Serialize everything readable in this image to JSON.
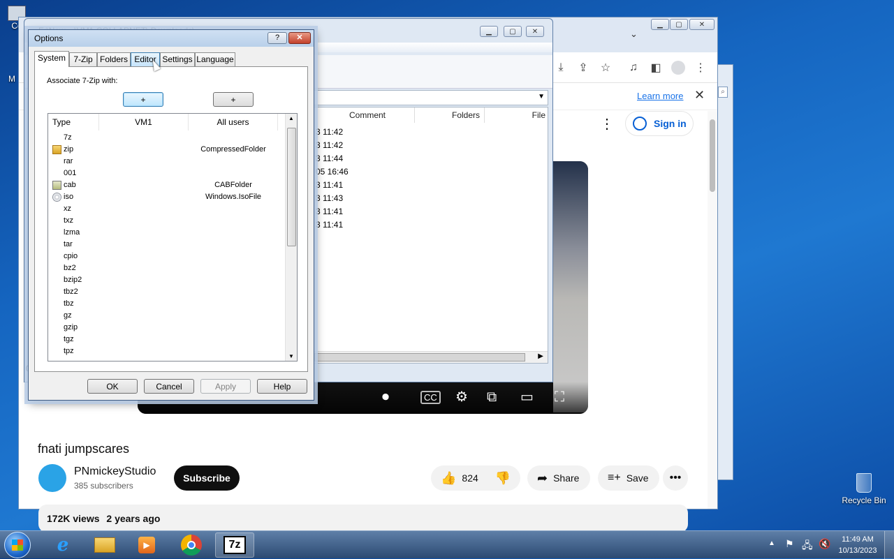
{
  "desktop": {
    "icon_top_left_label": "Co",
    "icon_left_label": "M",
    "recycle_bin_label": "Recycle Bin"
  },
  "chrome": {
    "infobar_link": "Learn more",
    "sign_in_label": "Sign in",
    "video_title": "fnati jumpscares",
    "channel_name": "PNmickeyStudio",
    "subscribers": "385 subscribers",
    "subscribe_label": "Subscribe",
    "like_count": "824",
    "share_label": "Share",
    "save_label": "Save",
    "views": "172K views",
    "age": "2 years ago"
  },
  "zip_window": {
    "title": "E:\\New... \\VM1 COLLAPNET\\ Downloads\\",
    "columns": [
      "Comment",
      "Folders",
      "File"
    ],
    "dates": [
      "3 11:42",
      "3 11:42",
      "3 11:44",
      "05 16:46",
      "3 11:41",
      "3 11:43",
      "3 11:41",
      "3 11:41"
    ],
    "status_left": "0"
  },
  "options": {
    "title": "Options",
    "help_glyph": "?",
    "close_glyph": "✕",
    "tabs": [
      "System",
      "7-Zip",
      "Folders",
      "Editor",
      "Settings",
      "Language"
    ],
    "associate_label": "Associate 7-Zip with:",
    "plus_label": "+",
    "list_headers": [
      "Type",
      "VM1",
      "All users"
    ],
    "rows": [
      {
        "ext": "7z",
        "all": ""
      },
      {
        "ext": "zip",
        "all": "CompressedFolder"
      },
      {
        "ext": "rar",
        "all": ""
      },
      {
        "ext": "001",
        "all": ""
      },
      {
        "ext": "cab",
        "all": "CABFolder"
      },
      {
        "ext": "iso",
        "all": "Windows.IsoFile"
      },
      {
        "ext": "xz",
        "all": ""
      },
      {
        "ext": "txz",
        "all": ""
      },
      {
        "ext": "lzma",
        "all": ""
      },
      {
        "ext": "tar",
        "all": ""
      },
      {
        "ext": "cpio",
        "all": ""
      },
      {
        "ext": "bz2",
        "all": ""
      },
      {
        "ext": "bzip2",
        "all": ""
      },
      {
        "ext": "tbz2",
        "all": ""
      },
      {
        "ext": "tbz",
        "all": ""
      },
      {
        "ext": "gz",
        "all": ""
      },
      {
        "ext": "gzip",
        "all": ""
      },
      {
        "ext": "tgz",
        "all": ""
      },
      {
        "ext": "tpz",
        "all": ""
      }
    ],
    "ok": "OK",
    "cancel": "Cancel",
    "apply": "Apply",
    "help": "Help"
  },
  "taskbar": {
    "time": "11:49 AM",
    "date": "10/13/2023",
    "zip_label": "7z"
  }
}
